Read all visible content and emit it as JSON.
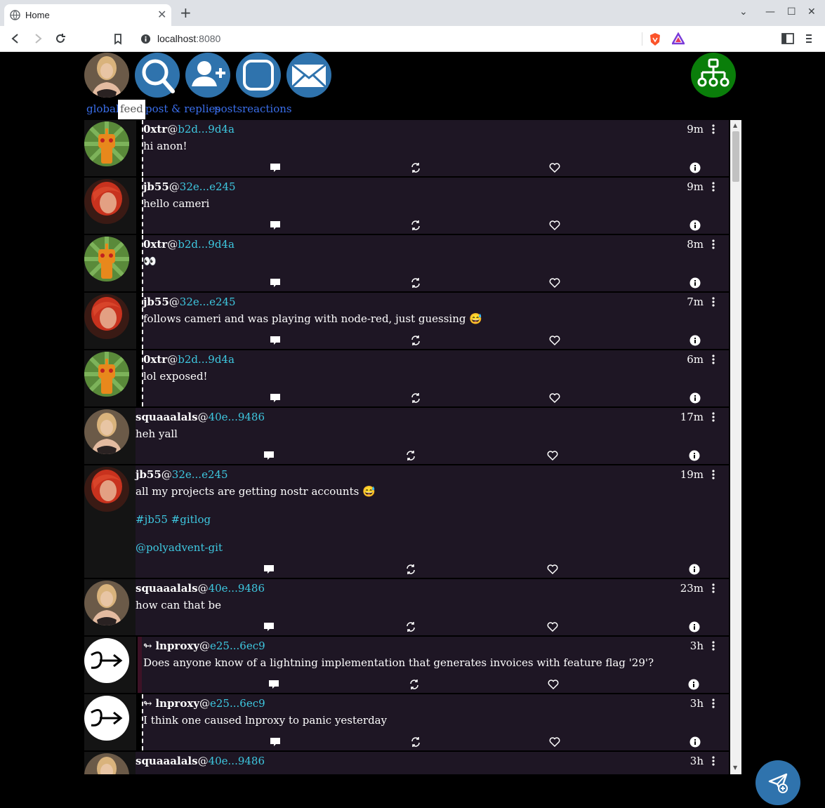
{
  "browser": {
    "tab_title": "Home",
    "url_host": "localhost",
    "url_port": ":8080"
  },
  "app": {
    "nav_tabs": [
      {
        "label": "global"
      },
      {
        "label": "feed"
      },
      {
        "label": "post & replies"
      },
      {
        "label": "posts"
      },
      {
        "label": "reactions"
      }
    ],
    "active_tab": "feed",
    "accent": "#2f73ad",
    "network_color": "#0a7e0a",
    "notes": [
      {
        "name": "0xtr",
        "key": "b2d...9d4a",
        "time": "9m",
        "text": "hi anon!"
      },
      {
        "name": "jb55",
        "key": "32e...e245",
        "time": "9m",
        "text": "hello cameri"
      },
      {
        "name": "0xtr",
        "key": "b2d...9d4a",
        "time": "8m",
        "text": "👀"
      },
      {
        "name": "jb55",
        "key": "32e...e245",
        "time": "7m",
        "text": "follows cameri and was playing with node-red, just guessing 😅"
      },
      {
        "name": "0xtr",
        "key": "b2d...9d4a",
        "time": "6m",
        "text": "lol exposed!"
      },
      {
        "name": "squaaalals",
        "key": "40e...9486",
        "time": "17m",
        "text": "heh yall"
      },
      {
        "name": "jb55",
        "key": "32e...e245",
        "time": "19m",
        "text": "all my projects are getting nostr accounts 😅",
        "tags": "#jb55 #gitlog",
        "mention": "@polyadvent-git"
      },
      {
        "name": "squaaalals",
        "key": "40e...9486",
        "time": "23m",
        "text": "how can that be"
      },
      {
        "name": "lnproxy",
        "prefix": "↬ ",
        "key": "e25...6ec9",
        "time": "3h",
        "text": "Does anyone know of a lightning implementation that generates invoices with feature flag '29'?"
      },
      {
        "name": "lnproxy",
        "prefix": "↬ ",
        "key": "e25...6ec9",
        "time": "3h",
        "text": "I think one caused lnproxy to panic yesterday"
      },
      {
        "name": "squaaalals",
        "key": "40e...9486",
        "time": "3h",
        "text": ""
      }
    ]
  }
}
